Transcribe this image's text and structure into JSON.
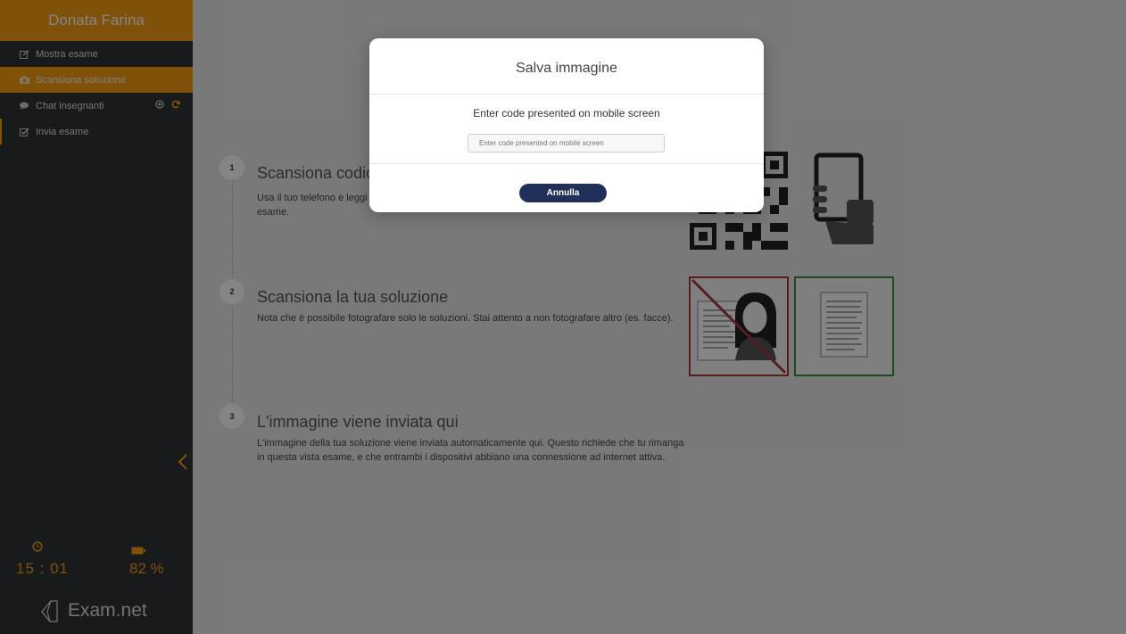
{
  "sidebar": {
    "user_name": "Donata Farina",
    "items": [
      {
        "label": "Mostra esame",
        "icon": "edit-icon"
      },
      {
        "label": "Scansiona soluzione",
        "icon": "camera-icon",
        "active": true
      },
      {
        "label": "Chat insegnanti",
        "icon": "chat-icon"
      },
      {
        "label": "Invia esame",
        "icon": "check-square-icon"
      }
    ],
    "timer": "15 : 01",
    "battery": "82 %",
    "logo_text": "Exam.net"
  },
  "steps": [
    {
      "number": "1",
      "title": "Scansiona codice",
      "desc": "Usa il tuo telefono e leggi il codice QR per collegare la fotocamera del telefono con il tuo esame."
    },
    {
      "number": "2",
      "title": "Scansiona la tua soluzione",
      "desc": "Nota che è possibile fotografare solo le soluzioni. Stai attento a non fotografare altro (es. facce)."
    },
    {
      "number": "3",
      "title": "L'immagine viene inviata qui",
      "desc": "L'immagine della tua soluzione viene inviata automaticamente qui. Questo richiede che tu rimanga in questa vista esame, e che entrambi i dispositivi abbiano una connessione ad internet attiva."
    }
  ],
  "modal": {
    "title": "Salva immagine",
    "label": "Enter code presented on mobile screen",
    "input_placeholder": "Enter code presented on mobile screen",
    "input_value": "",
    "cancel_label": "Annulla"
  },
  "colors": {
    "accent": "#f39c12",
    "sidebar_bg": "#2f3236",
    "button_navy": "#20305a",
    "bad_border": "#a73a3a",
    "good_border": "#3d8c40"
  }
}
